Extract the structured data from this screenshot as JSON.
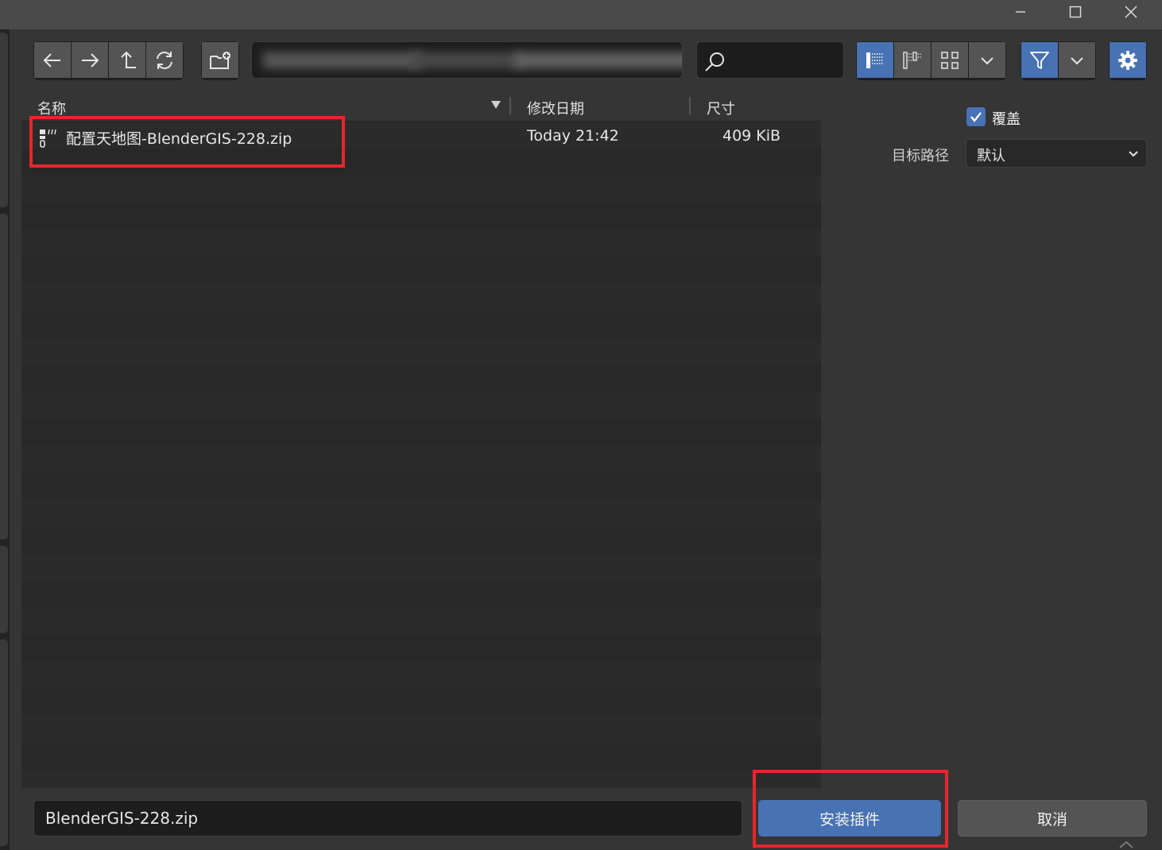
{
  "toolbar": {
    "back_icon": "arrow-left-icon",
    "forward_icon": "arrow-right-icon",
    "parent_icon": "parent-directory-icon",
    "refresh_icon": "refresh-icon",
    "new_folder_icon": "new-folder-icon",
    "path_value": "",
    "search_value": "",
    "view_modes": [
      "vertical-list",
      "horizontal-list",
      "thumbnails"
    ],
    "active_view": "vertical-list",
    "filter_active": true
  },
  "columns": {
    "name": "名称",
    "date": "修改日期",
    "size": "尺寸"
  },
  "files": [
    {
      "name": "配置天地图-BlenderGIS-228.zip",
      "date": "Today 21:42",
      "size": "409 KiB",
      "icon": "zip-file-icon"
    }
  ],
  "sidebar": {
    "overwrite_label": "覆盖",
    "overwrite_checked": true,
    "target_path_label": "目标路径",
    "target_path_value": "默认"
  },
  "footer": {
    "filename_value": "BlenderGIS-228.zip",
    "install_label": "安装插件",
    "cancel_label": "取消"
  },
  "colors": {
    "accent": "#4772b3",
    "highlight_box": "#e8262b",
    "background": "#353535"
  }
}
